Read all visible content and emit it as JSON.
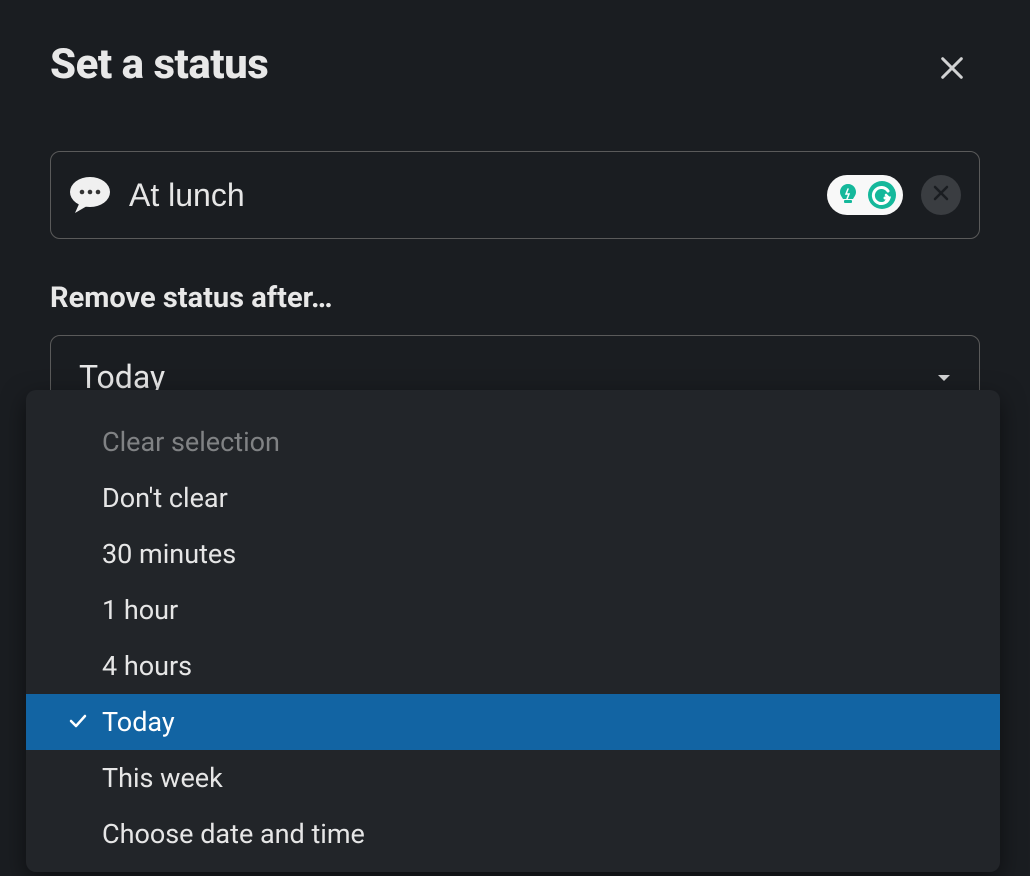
{
  "modal": {
    "title": "Set a status"
  },
  "status": {
    "text": "At lunch",
    "emoji": "speech_balloon"
  },
  "remove_after": {
    "label": "Remove status after…",
    "selected": "Today",
    "options": [
      {
        "label": "Clear selection",
        "muted": true,
        "selected": false
      },
      {
        "label": "Don't clear",
        "muted": false,
        "selected": false
      },
      {
        "label": "30 minutes",
        "muted": false,
        "selected": false
      },
      {
        "label": "1 hour",
        "muted": false,
        "selected": false
      },
      {
        "label": "4 hours",
        "muted": false,
        "selected": false
      },
      {
        "label": "Today",
        "muted": false,
        "selected": true
      },
      {
        "label": "This week",
        "muted": false,
        "selected": false
      },
      {
        "label": "Choose date and time",
        "muted": false,
        "selected": false
      }
    ]
  }
}
